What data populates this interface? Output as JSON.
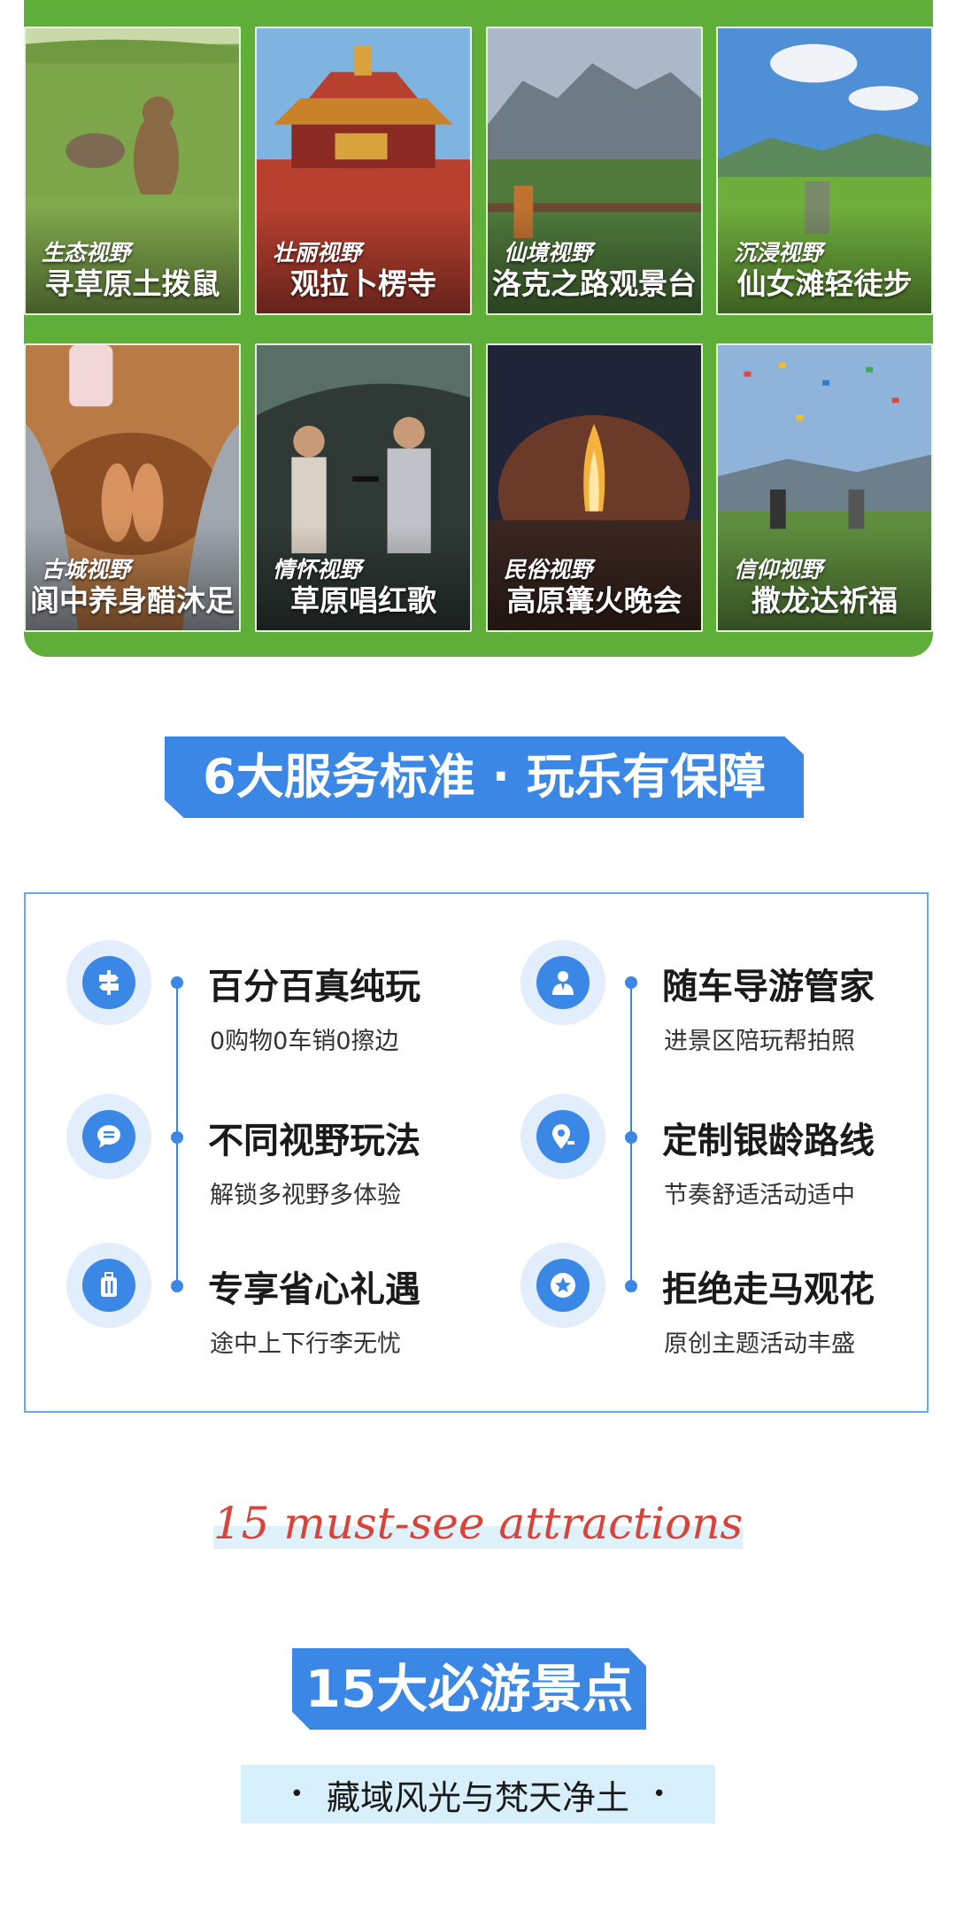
{
  "attractions_grid": [
    {
      "tag": "生态视野",
      "name": "寻草原土拨鼠"
    },
    {
      "tag": "壮丽视野",
      "name": "观拉卜楞寺"
    },
    {
      "tag": "仙境视野",
      "name": "洛克之路观景台"
    },
    {
      "tag": "沉浸视野",
      "name": "仙女滩轻徒步"
    },
    {
      "tag": "古城视野",
      "name": "阆中养身醋沐足"
    },
    {
      "tag": "情怀视野",
      "name": "草原唱红歌"
    },
    {
      "tag": "民俗视野",
      "name": "高原篝火晚会"
    },
    {
      "tag": "信仰视野",
      "name": "撒龙达祈福"
    }
  ],
  "service_banner": {
    "title": "6大服务标准 · 玩乐有保障"
  },
  "services": [
    {
      "icon": "signpost-icon",
      "title": "百分百真纯玩",
      "subtitle": "0购物0车销0擦边"
    },
    {
      "icon": "tour-guide-icon",
      "title": "随车导游管家",
      "subtitle": "进景区陪玩帮拍照"
    },
    {
      "icon": "chat-bubble-icon",
      "title": "不同视野玩法",
      "subtitle": "解锁多视野多体验"
    },
    {
      "icon": "location-pin-icon",
      "title": "定制银龄路线",
      "subtitle": "节奏舒适活动适中"
    },
    {
      "icon": "luggage-icon",
      "title": "专享省心礼遇",
      "subtitle": "途中上下行李无忧"
    },
    {
      "icon": "star-icon",
      "title": "拒绝走马观花",
      "subtitle": "原创主题活动丰盛"
    }
  ],
  "attractions_heading": {
    "script": "15 must-see attractions",
    "banner": "15大必游景点",
    "subtitle": "藏域风光与梵天净土",
    "bullet": "•"
  },
  "colors": {
    "green": "#5fae39",
    "blue": "#3a87e6",
    "script_red": "#d9443a",
    "light_blue": "#d7f0fb"
  }
}
